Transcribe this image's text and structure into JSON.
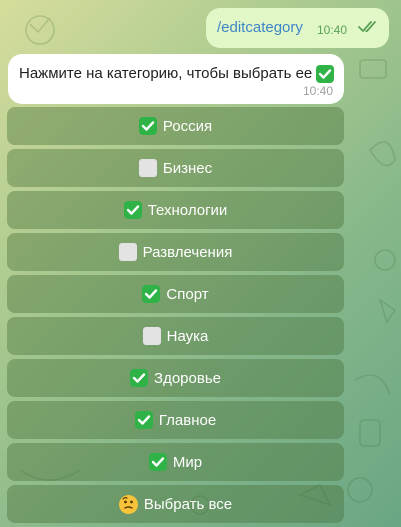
{
  "outgoing": {
    "text": "/editcategory",
    "time": "10:40",
    "icon": "double-check-icon"
  },
  "incoming": {
    "text": "Нажмите на категорию, чтобы выбрать ее",
    "trailing_icon": "check-mark-icon",
    "time": "10:40"
  },
  "keyboard": [
    {
      "label": "Россия",
      "icon": "check-mark-icon",
      "selected": true
    },
    {
      "label": "Бизнес",
      "icon": "empty-square-icon",
      "selected": false
    },
    {
      "label": "Технологии",
      "icon": "check-mark-icon",
      "selected": true
    },
    {
      "label": "Развлечения",
      "icon": "empty-square-icon",
      "selected": false
    },
    {
      "label": "Спорт",
      "icon": "check-mark-icon",
      "selected": true
    },
    {
      "label": "Наука",
      "icon": "empty-square-icon",
      "selected": false
    },
    {
      "label": "Здоровье",
      "icon": "check-mark-icon",
      "selected": true
    },
    {
      "label": "Главное",
      "icon": "check-mark-icon",
      "selected": true
    },
    {
      "label": "Мир",
      "icon": "check-mark-icon",
      "selected": true
    },
    {
      "label": "Выбрать все",
      "icon": "thinking-face-icon",
      "selected": null
    }
  ],
  "colors": {
    "check": "#2fb347",
    "link": "#3f86c6",
    "outgoing_bg": "#e1f7c8"
  }
}
